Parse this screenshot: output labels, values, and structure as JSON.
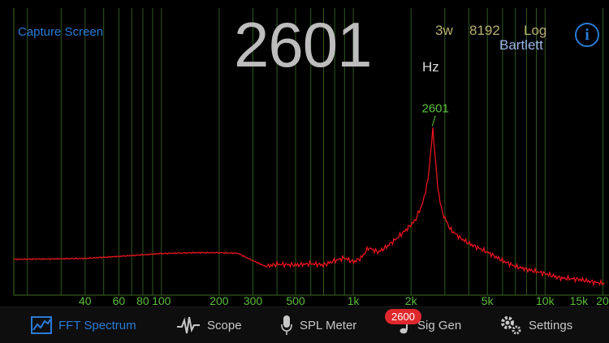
{
  "header": {
    "capture_label": "Capture Screen",
    "frequency": "2601",
    "unit": "Hz",
    "averaging": "3w",
    "fft_size": "8192",
    "scale": "Log",
    "window": "Bartlett",
    "info_icon": "info-icon"
  },
  "colors": {
    "accent": "#2a7bd6",
    "grid": "#2f5a1e",
    "trace": "#e8141e",
    "axis_label": "#5bbf3a",
    "badge": "#e0282c"
  },
  "chart_data": {
    "type": "line",
    "x_scale": "log",
    "xlim": [
      17,
      20500
    ],
    "tick_labels": [
      {
        "value": 40,
        "label": "40"
      },
      {
        "value": 60,
        "label": "60"
      },
      {
        "value": 80,
        "label": "80"
      },
      {
        "value": 100,
        "label": "100"
      },
      {
        "value": 200,
        "label": "200"
      },
      {
        "value": 300,
        "label": "300"
      },
      {
        "value": 500,
        "label": "500"
      },
      {
        "value": 1000,
        "label": "1k"
      },
      {
        "value": 2000,
        "label": "2k"
      },
      {
        "value": 5000,
        "label": "5k"
      },
      {
        "value": 10000,
        "label": "10k"
      },
      {
        "value": 15000,
        "label": "15k"
      },
      {
        "value": 20000,
        "label": "20"
      }
    ],
    "gridlines": [
      20,
      30,
      40,
      50,
      60,
      70,
      80,
      90,
      100,
      200,
      300,
      400,
      500,
      600,
      700,
      800,
      900,
      1000,
      2000,
      3000,
      4000,
      5000,
      6000,
      7000,
      8000,
      9000,
      10000,
      20000
    ],
    "peak": {
      "x": 2601,
      "label": "2601"
    },
    "ylim": [
      0,
      1
    ],
    "x": [
      17,
      25,
      40,
      60,
      100,
      150,
      200,
      250,
      300,
      350,
      400,
      500,
      600,
      700,
      800,
      900,
      1000,
      1100,
      1200,
      1350,
      1500,
      1700,
      1900,
      2100,
      2300,
      2450,
      2550,
      2601,
      2660,
      2750,
      2900,
      3200,
      3600,
      4000,
      5000,
      6000,
      7000,
      8000,
      10000,
      12000,
      15000,
      18000,
      20500
    ],
    "y": [
      0.125,
      0.126,
      0.128,
      0.135,
      0.145,
      0.148,
      0.148,
      0.146,
      0.12,
      0.1,
      0.108,
      0.105,
      0.11,
      0.105,
      0.12,
      0.13,
      0.115,
      0.13,
      0.165,
      0.15,
      0.17,
      0.2,
      0.23,
      0.26,
      0.32,
      0.4,
      0.52,
      0.58,
      0.5,
      0.38,
      0.29,
      0.23,
      0.2,
      0.18,
      0.15,
      0.12,
      0.1,
      0.09,
      0.075,
      0.06,
      0.055,
      0.045,
      0.04
    ]
  },
  "tabs": [
    {
      "label": "FFT Spectrum",
      "icon": "spectrum-icon",
      "active": true
    },
    {
      "label": "Scope",
      "icon": "waveform-icon"
    },
    {
      "label": "SPL Meter",
      "icon": "microphone-icon"
    },
    {
      "label": "Sig Gen",
      "icon": "music-note-icon",
      "badge": "2600"
    },
    {
      "label": "Settings",
      "icon": "gears-icon"
    }
  ]
}
